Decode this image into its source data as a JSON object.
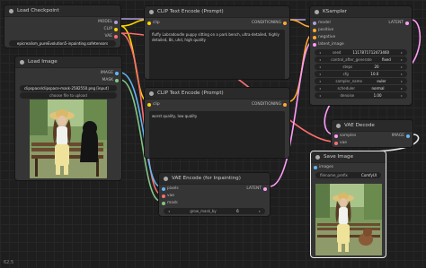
{
  "checkpoint": {
    "title": "Load Checkpoint",
    "outputs": [
      "MODEL",
      "CLIP",
      "VAE"
    ],
    "ckpt_name": "epicrealism_pureEvolution5-inpainting.safetensors"
  },
  "load_image": {
    "title": "Load Image",
    "outputs": [
      "IMAGE",
      "MASK"
    ],
    "image": "clipspace/clipspace-mask-2582550.png [input]",
    "upload_label": "choose file to upload"
  },
  "clip_pos": {
    "title": "CLIP Text Encode (Prompt)",
    "input": "clip",
    "output": "CONDITIONING",
    "text": "fluffy Labradoodle puppy sitting on a park bench, ultra-detailed, highly detailed, 8k, uhd, high quality"
  },
  "clip_neg": {
    "title": "CLIP Text Encode (Prompt)",
    "input": "clip",
    "output": "CONDITIONING",
    "text": "worst quality, low quality"
  },
  "ksampler": {
    "title": "KSampler",
    "inputs": [
      "model",
      "positive",
      "negative",
      "latent_image"
    ],
    "output": "LATENT",
    "widgets": [
      {
        "label": "seed",
        "value": "1117871712473460"
      },
      {
        "label": "control_after_generate",
        "value": "fixed"
      },
      {
        "label": "steps",
        "value": "20"
      },
      {
        "label": "cfg",
        "value": "10.0"
      },
      {
        "label": "sampler_name",
        "value": "euler"
      },
      {
        "label": "scheduler",
        "value": "normal"
      },
      {
        "label": "denoise",
        "value": "1.00"
      }
    ]
  },
  "vae_decode": {
    "title": "VAE Decode",
    "inputs": [
      "samples",
      "vae"
    ],
    "output": "IMAGE"
  },
  "vae_encode": {
    "title": "VAE Encode (for Inpainting)",
    "inputs": [
      "pixels",
      "vae",
      "mask"
    ],
    "output": "LATENT",
    "widget": {
      "label": "grow_mask_by",
      "value": "6"
    }
  },
  "save_image": {
    "title": "Save Image",
    "input": "images",
    "widget": {
      "label": "filename_prefix",
      "value": "ComfyUI"
    }
  },
  "colors": {
    "model": "#b39ddb",
    "clip": "#ffd500",
    "vae": "#ff6e6e",
    "conditioning": "#ffa931",
    "latent": "#ff9cf9",
    "image": "#64b5f6",
    "mask": "#81c784"
  },
  "status": "62.5"
}
